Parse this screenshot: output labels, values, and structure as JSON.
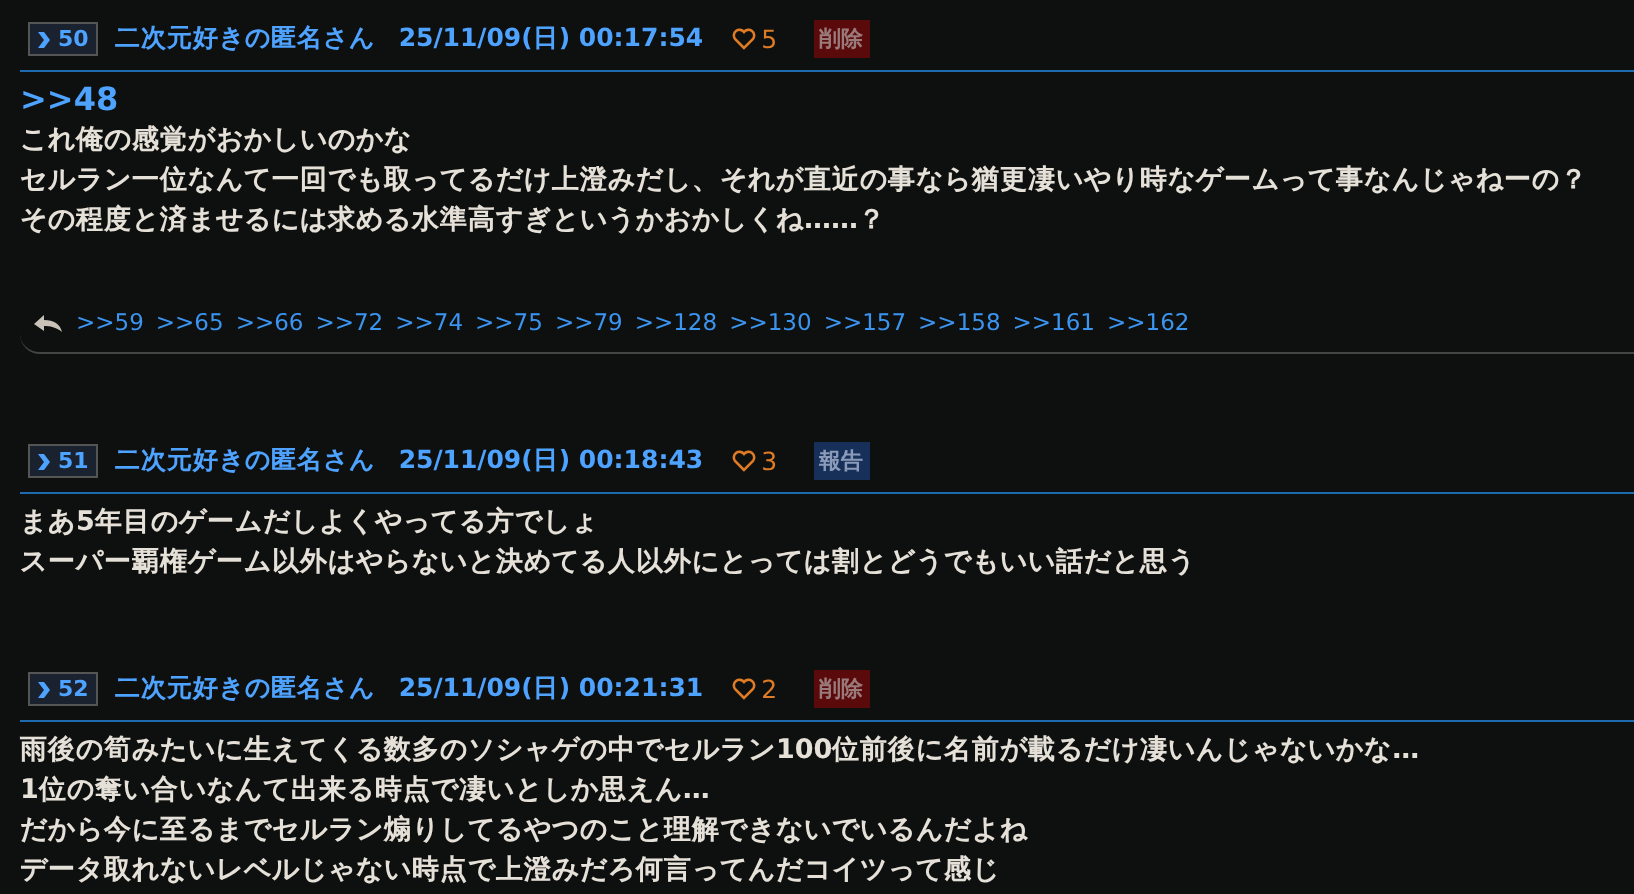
{
  "posts": [
    {
      "number": "50",
      "name": "二次元好きの匿名さん",
      "date": "25/11/09(日) 00:17:54",
      "likes": "5",
      "action": {
        "kind": "delete",
        "label": "削除"
      },
      "anchor": ">>48",
      "lines": [
        "これ俺の感覚がおかしいのかな",
        "セルラン一位なんて一回でも取ってるだけ上澄みだし、それが直近の事なら猶更凄いやり時なゲームって事なんじゃねーの？",
        "その程度と済ませるには求める水準高すぎというかおかしくね……？"
      ],
      "replies": [
        ">>59",
        ">>65",
        ">>66",
        ">>72",
        ">>74",
        ">>75",
        ">>79",
        ">>128",
        ">>130",
        ">>157",
        ">>158",
        ">>161",
        ">>162"
      ]
    },
    {
      "number": "51",
      "name": "二次元好きの匿名さん",
      "date": "25/11/09(日) 00:18:43",
      "likes": "3",
      "action": {
        "kind": "report",
        "label": "報告"
      },
      "lines": [
        "まあ5年目のゲームだしよくやってる方でしょ",
        "スーパー覇権ゲーム以外はやらないと決めてる人以外にとっては割とどうでもいい話だと思う"
      ]
    },
    {
      "number": "52",
      "name": "二次元好きの匿名さん",
      "date": "25/11/09(日) 00:21:31",
      "likes": "2",
      "action": {
        "kind": "delete",
        "label": "削除"
      },
      "lines": [
        "雨後の筍みたいに生えてくる数多のソシャゲの中でセルラン100位前後に名前が載るだけ凄いんじゃないかな…",
        "1位の奪い合いなんて出来る時点で凄いとしか思えん…",
        "だから今に至るまでセルラン煽りしてるやつのこと理解できないでいるんだよね",
        "データ取れないレベルじゃない時点で上澄みだろ何言ってんだコイツって感じ"
      ]
    }
  ]
}
